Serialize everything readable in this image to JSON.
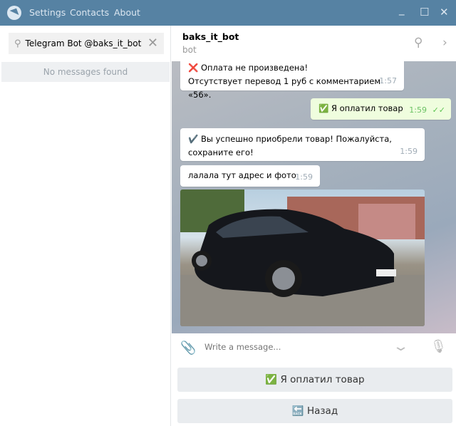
{
  "titlebar": {
    "menu": [
      "Settings",
      "Contacts",
      "About"
    ],
    "controls": {
      "minimize": "_",
      "maximize": "☐",
      "close": "✕"
    }
  },
  "sidebar": {
    "search_value": "Telegram Bot @baks_it_bot",
    "empty_text": "No messages found"
  },
  "header": {
    "name": "baks_it_bot",
    "status": "bot"
  },
  "messages": [
    {
      "direction": "in",
      "icon": "❌",
      "lines": [
        "Оплата не произведена!",
        "Отсутствует перевод 1 руб с комментарием «56»."
      ],
      "time": "1:57"
    },
    {
      "direction": "out",
      "icon": "✅",
      "lines": [
        "Я оплатил товар"
      ],
      "time": "1:59",
      "read": true
    },
    {
      "direction": "in",
      "icon": "✔️",
      "lines": [
        "Вы успешно приобрели товар! Пожалуйста,",
        "сохраните его!"
      ],
      "time": "1:59"
    },
    {
      "direction": "in",
      "lines": [
        "лалала тут адрес и фото"
      ],
      "time": "1:59"
    },
    {
      "direction": "in",
      "type": "photo"
    }
  ],
  "composer": {
    "placeholder": "Write a message..."
  },
  "keyboard": [
    {
      "label": "✅ Я оплатил товар"
    },
    {
      "label": "🔙 Назад"
    }
  ],
  "colors": {
    "titlebar": "#5682a3",
    "outgoing": "#effdde",
    "button": "#e9ecef"
  }
}
